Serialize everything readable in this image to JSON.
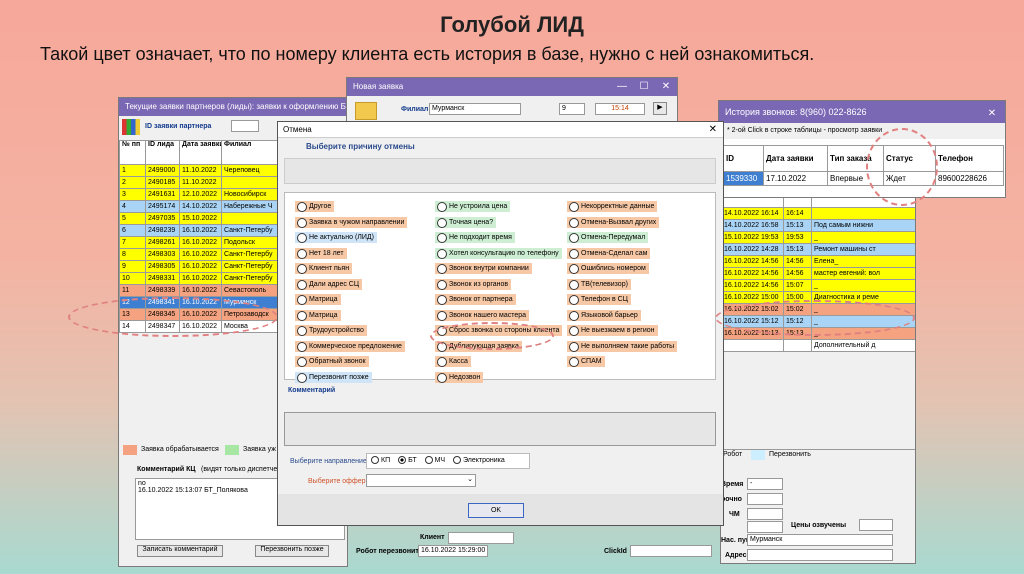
{
  "slide": {
    "title": "Голубой ЛИД",
    "subtitle": "Такой цвет означает, что по номеру клиента есть история в базе, нужно с ней ознакомиться."
  },
  "left_window": {
    "title": "Текущие заявки партнеров (лиды): заявки к оформлению БТ + заявки в",
    "id_label": "ID заявки партнера",
    "headers": [
      "№ пп",
      "ID лида",
      "Дата заявки",
      "Филиал"
    ],
    "rows": [
      {
        "n": "1",
        "id": "2499000",
        "date": "11.10.2022",
        "branch": "Череповец",
        "color": "yellow"
      },
      {
        "n": "2",
        "id": "2490185",
        "date": "11.10.2022",
        "branch": "",
        "color": "yellow"
      },
      {
        "n": "3",
        "id": "2491631",
        "date": "12.10.2022",
        "branch": "Новосибирск",
        "color": "yellow"
      },
      {
        "n": "4",
        "id": "2495174",
        "date": "14.10.2022",
        "branch": "Набережные Ч",
        "color": "blue"
      },
      {
        "n": "5",
        "id": "2497035",
        "date": "15.10.2022",
        "branch": "",
        "color": "yellow"
      },
      {
        "n": "6",
        "id": "2498239",
        "date": "16.10.2022",
        "branch": "Санкт-Петербу",
        "color": "blue"
      },
      {
        "n": "7",
        "id": "2498261",
        "date": "16.10.2022",
        "branch": "Подольск",
        "color": "yellow"
      },
      {
        "n": "8",
        "id": "2498303",
        "date": "16.10.2022",
        "branch": "Санкт-Петербу",
        "color": "yellow"
      },
      {
        "n": "9",
        "id": "2498305",
        "date": "16.10.2022",
        "branch": "Санкт-Петербу",
        "color": "yellow"
      },
      {
        "n": "10",
        "id": "2498331",
        "date": "16.10.2022",
        "branch": "Санкт-Петербу",
        "color": "yellow"
      },
      {
        "n": "11",
        "id": "2498339",
        "date": "16.10.2022",
        "branch": "Севастополь",
        "color": "orange"
      },
      {
        "n": "12",
        "id": "2498341",
        "date": "16.10.2022",
        "branch": "Мурманск",
        "color": "sel"
      },
      {
        "n": "13",
        "id": "2498345",
        "date": "16.10.2022",
        "branch": "Петрозаводск",
        "color": "orange"
      },
      {
        "n": "14",
        "id": "2498347",
        "date": "16.10.2022",
        "branch": "Москва",
        "color": "white"
      }
    ],
    "legend_1": "Заявка обрабатывается",
    "legend_2": "Заявка уж",
    "comment_label": "Комментарий КЦ",
    "comment_hint": "(видят только диспетчеры",
    "comment_text_1": "no",
    "comment_text_2": "16.10.2022 15:13:07  БТ_Полякова",
    "btn_write": "Записать комментарий",
    "btn_recall": "Перезвонить позже"
  },
  "new_window": {
    "title": "Новая заявка",
    "branch_label": "Филиал",
    "branch_value": "Мурманск",
    "num_value": "9",
    "time_value": "15:14"
  },
  "cancel_dialog": {
    "title": "Отмена",
    "heading": "Выберите причину отмены",
    "col1": [
      {
        "label": "Другое",
        "color": "orange"
      },
      {
        "label": "Заявка в чужом направлении",
        "color": "orange"
      },
      {
        "label": "Не актуально (ЛИД)",
        "color": "blue"
      },
      {
        "label": "Нет 18 лет",
        "color": "orange"
      },
      {
        "label": "Клиент пьян",
        "color": "orange"
      },
      {
        "label": "Дали адрес СЦ",
        "color": "orange"
      },
      {
        "label": "Матрица",
        "color": "orange"
      },
      {
        "label": "Матрица",
        "color": "orange"
      },
      {
        "label": "Трудоустройство",
        "color": "orange"
      },
      {
        "label": "Коммерческое предложение",
        "color": "orange"
      },
      {
        "label": "Обратный звонок",
        "color": "orange"
      },
      {
        "label": "Перезвонит позже",
        "color": "blue"
      }
    ],
    "col2": [
      {
        "label": "Не устроила цена",
        "color": "green"
      },
      {
        "label": "Точная цена?",
        "color": "green"
      },
      {
        "label": "Не подходит время",
        "color": "green"
      },
      {
        "label": "Хотел консультацию по телефону",
        "color": "green"
      },
      {
        "label": "Звонок внутри компании",
        "color": "orange"
      },
      {
        "label": "Звонок из органов",
        "color": "orange"
      },
      {
        "label": "Звонок от партнера",
        "color": "orange"
      },
      {
        "label": "Звонок нашего мастера",
        "color": "orange"
      },
      {
        "label": "Сброс звонка со стороны клиента",
        "color": "orange"
      },
      {
        "label": "Дублирующая заявка",
        "color": "orange"
      },
      {
        "label": "Касса",
        "color": "orange"
      },
      {
        "label": "Недозвон",
        "color": "orange"
      }
    ],
    "col3": [
      {
        "label": "Некорректные данные",
        "color": "orange"
      },
      {
        "label": "Отмена-Вызвал других",
        "color": "orange"
      },
      {
        "label": "Отмена-Передумал",
        "color": "green"
      },
      {
        "label": "Отмена-Сделал сам",
        "color": "orange"
      },
      {
        "label": "Ошиблись номером",
        "color": "orange"
      },
      {
        "label": "ТВ(телевизор)",
        "color": "orange"
      },
      {
        "label": "Телефон в СЦ",
        "color": "orange"
      },
      {
        "label": "Языковой барьер",
        "color": "orange"
      },
      {
        "label": "Не выезжаем в регион",
        "color": "orange"
      },
      {
        "label": "Не выполняем такие работы",
        "color": "orange"
      },
      {
        "label": "СПАМ",
        "color": "orange"
      }
    ],
    "comment_label": "Комментарий",
    "direction_label": "Выберите направление",
    "dir_kp": "КП",
    "dir_bt": "БТ",
    "dir_mch": "МЧ",
    "dir_el": "Электроника",
    "offer_label": "Выберите оффер",
    "ok": "OK"
  },
  "history_window": {
    "title": "История звонков: 8(960) 022-8626",
    "hint": "* 2-ой Click в строке таблицы - просмотр заявки",
    "headers": [
      "ID",
      "Дата заявки",
      "Тип заказа",
      "Статус",
      "Телефон"
    ],
    "row": [
      "1539330",
      "17.10.2022",
      "Впервые",
      "Ждет",
      "89600228626"
    ]
  },
  "right_table": {
    "rows": [
      {
        "date": "14.10.2022 16:14",
        "time": "16:14",
        "note": "",
        "color": "yellow"
      },
      {
        "date": "14.10.2022 16:58",
        "time": "15:13",
        "note": "Под самым нижни",
        "color": "blue"
      },
      {
        "date": "15.10.2022 19:53",
        "time": "19:53",
        "note": "_",
        "color": "yellow"
      },
      {
        "date": "16.10.2022 14:28",
        "time": "15:13",
        "note": "Ремонт машины ст",
        "color": "blue"
      },
      {
        "date": "16.10.2022 14:56",
        "time": "14:56",
        "note": "Елена_",
        "color": "yellow"
      },
      {
        "date": "16.10.2022 14:56",
        "time": "14:56",
        "note": "мастер евгений: вол",
        "color": "yellow"
      },
      {
        "date": "16.10.2022 14:56",
        "time": "15:07",
        "note": "_",
        "color": "yellow"
      },
      {
        "date": "16.10.2022 15:00",
        "time": "15:00",
        "note": "Диагностика и реме",
        "color": "yellow"
      },
      {
        "date": "16.10.2022 15:02",
        "time": "15:02",
        "note": "_",
        "color": "orange"
      },
      {
        "date": "16.10.2022 15:12",
        "time": "15:12",
        "note": "_",
        "color": "blue"
      },
      {
        "date": "16.10.2022 15:13",
        "time": "15:13",
        "note": "_",
        "color": "orange"
      },
      {
        "date": "",
        "time": "",
        "note": "Дополнительный д",
        "color": "white"
      }
    ],
    "legend_robot": "Робот",
    "legend_recall": "Перезвонить",
    "label_time": "Время",
    "label_urgent": "рочно",
    "label_chm": "ЧМ",
    "label_prices": "Цены озвучены",
    "label_city": "Нас. пункт",
    "city_value": "Мурманск",
    "label_address": "Адрес",
    "dash": "-"
  },
  "bottom": {
    "client_label": "Клиент",
    "robot_label": "Робот перезвонит",
    "robot_value": "16.10.2022 15:29:00",
    "clickid_label": "ClickId"
  }
}
